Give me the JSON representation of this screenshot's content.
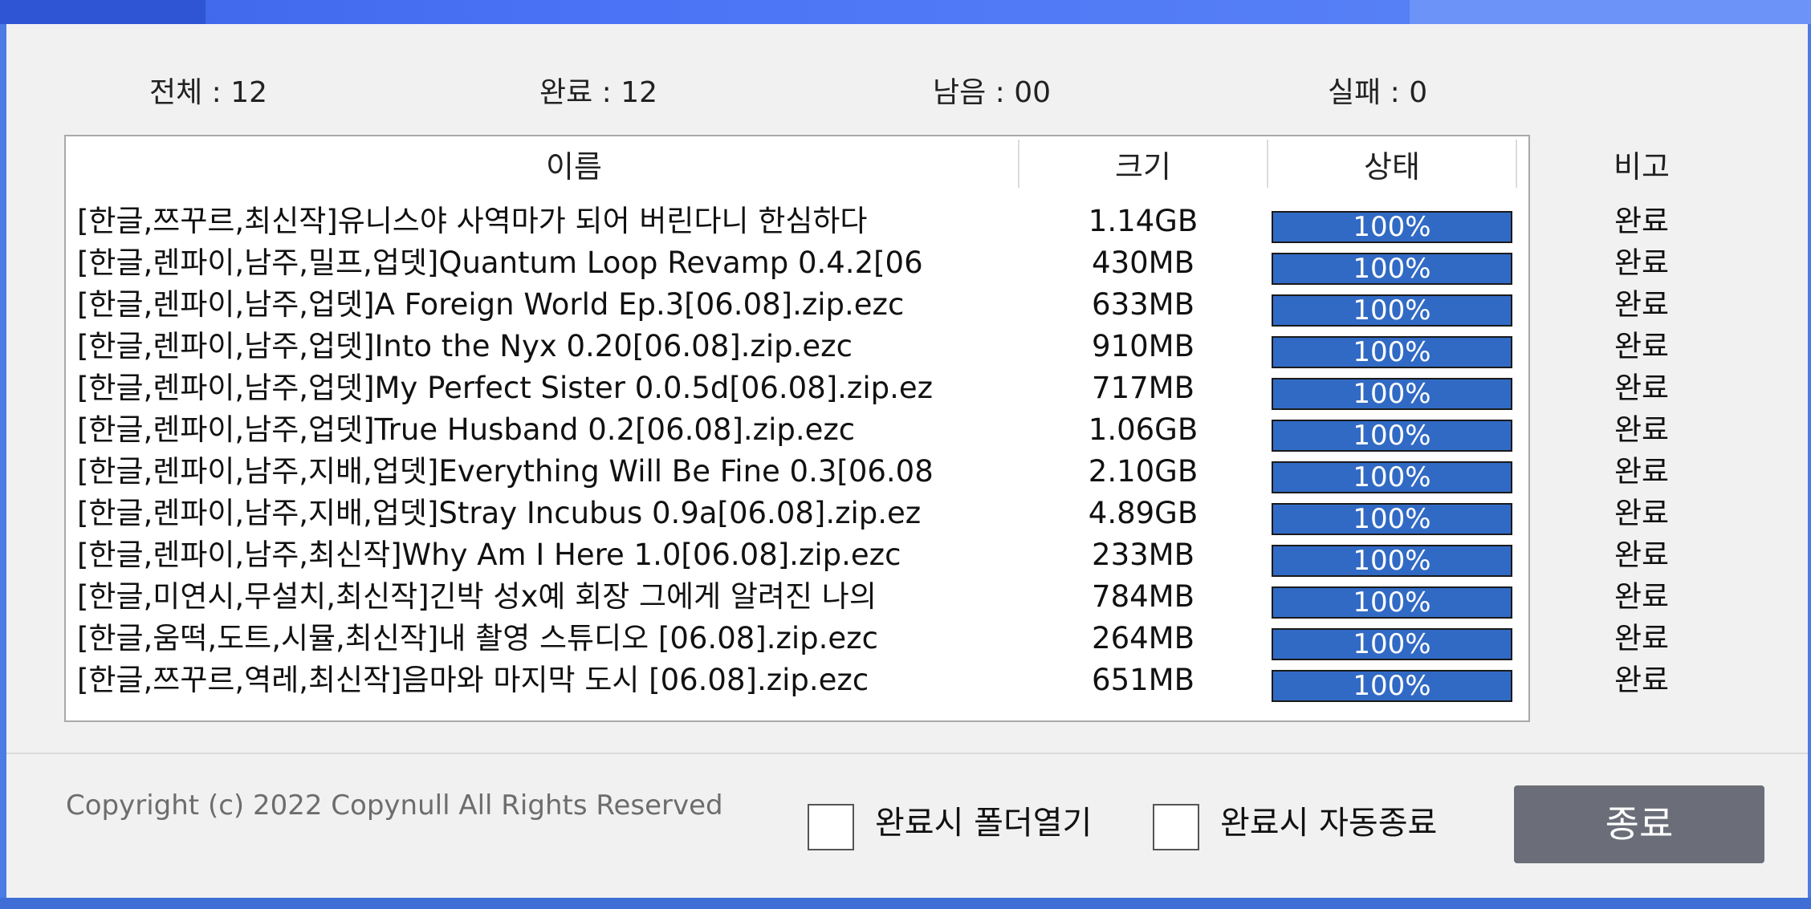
{
  "stats": {
    "total": {
      "label": "전체 : ",
      "value": "12"
    },
    "done": {
      "label": "완료 : ",
      "value": "12"
    },
    "remaining": {
      "label": "남음 : ",
      "value": "00"
    },
    "failed": {
      "label": "실패 : ",
      "value": "0"
    }
  },
  "table": {
    "headers": {
      "name": "이름",
      "size": "크기",
      "status": "상태",
      "note": "비고"
    },
    "rows": [
      {
        "name": "[한글,쯔꾸르,최신작]유니스야 사역마가 되어 버린다니 한심하다",
        "size": "1.14GB",
        "progress": "100%",
        "note": "완료"
      },
      {
        "name": "[한글,렌파이,남주,밀프,업뎃]Quantum Loop Revamp 0.4.2[06",
        "size": "430MB",
        "progress": "100%",
        "note": "완료"
      },
      {
        "name": "[한글,렌파이,남주,업뎃]A Foreign World Ep.3[06.08].zip.ezc",
        "size": "633MB",
        "progress": "100%",
        "note": "완료"
      },
      {
        "name": "[한글,렌파이,남주,업뎃]Into the Nyx 0.20[06.08].zip.ezc",
        "size": "910MB",
        "progress": "100%",
        "note": "완료"
      },
      {
        "name": "[한글,렌파이,남주,업뎃]My Perfect Sister 0.0.5d[06.08].zip.ez",
        "size": "717MB",
        "progress": "100%",
        "note": "완료"
      },
      {
        "name": "[한글,렌파이,남주,업뎃]True Husband 0.2[06.08].zip.ezc",
        "size": "1.06GB",
        "progress": "100%",
        "note": "완료"
      },
      {
        "name": "[한글,렌파이,남주,지배,업뎃]Everything Will Be Fine 0.3[06.08",
        "size": "2.10GB",
        "progress": "100%",
        "note": "완료"
      },
      {
        "name": "[한글,렌파이,남주,지배,업뎃]Stray Incubus 0.9a[06.08].zip.ez",
        "size": "4.89GB",
        "progress": "100%",
        "note": "완료"
      },
      {
        "name": "[한글,렌파이,남주,최신작]Why Am I Here 1.0[06.08].zip.ezc",
        "size": "233MB",
        "progress": "100%",
        "note": "완료"
      },
      {
        "name": "[한글,미연시,무설치,최신작]긴박 성x예 회장 그에게 알려진 나의",
        "size": "784MB",
        "progress": "100%",
        "note": "완료"
      },
      {
        "name": "[한글,움떡,도트,시뮬,최신작]내 촬영 스튜디오 [06.08].zip.ezc",
        "size": "264MB",
        "progress": "100%",
        "note": "완료"
      },
      {
        "name": "[한글,쯔꾸르,역레,최신작]음마와 마지막 도시 [06.08].zip.ezc",
        "size": "651MB",
        "progress": "100%",
        "note": "완료"
      }
    ]
  },
  "footer": {
    "copyright": "Copyright (c) 2022 Copynull All Rights Reserved",
    "open_folder_label": "완료시 폴더열기",
    "auto_close_label": "완료시 자동종료",
    "close_button": "종료"
  },
  "colors": {
    "progress_fill": "#316ac5",
    "title_bar": "#4a74f5",
    "close_button_bg": "#6b6e78"
  }
}
